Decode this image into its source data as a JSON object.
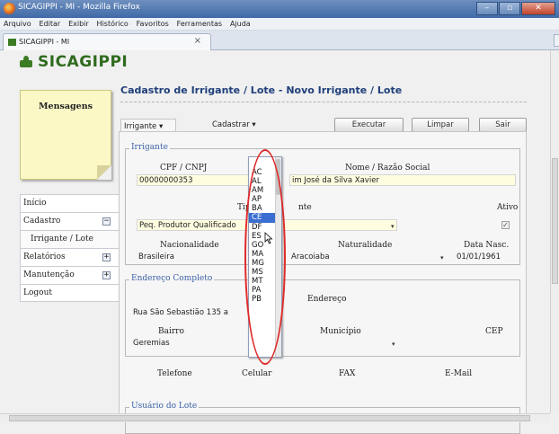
{
  "browser": {
    "window_title": "SICAGIPPI - MI - Mozilla Firefox",
    "menu": [
      "Arquivo",
      "Editar",
      "Exibir",
      "Histórico",
      "Favoritos",
      "Ferramentas",
      "Ajuda"
    ],
    "tab_label": "SICAGIPPI - MI",
    "tab_close": "×"
  },
  "app": {
    "logo_text": "SICAGIPPI",
    "messages_title": "Mensagens"
  },
  "nav": {
    "items": [
      {
        "label": "Início",
        "toggle": ""
      },
      {
        "label": "Cadastro",
        "toggle": "−"
      },
      {
        "label": "Irrigante / Lote",
        "toggle": ""
      },
      {
        "label": "Relatórios",
        "toggle": "+"
      },
      {
        "label": "Manutenção",
        "toggle": "+"
      },
      {
        "label": "Logout",
        "toggle": ""
      }
    ]
  },
  "page": {
    "title": "Cadastro de Irrigante / Lote - Novo Irrigante / Lote"
  },
  "toolbar": {
    "tab_irrigante": "Irrigante",
    "cadastrar": "Cadastrar",
    "executar": "Executar",
    "limpar": "Limpar",
    "sair": "Sair"
  },
  "irrigante": {
    "legend": "Irrigante",
    "cpf_label": "CPF / CNPJ",
    "cpf_value": "00000000353",
    "nome_label": "Nome / Razão Social",
    "nome_value": "im José da Silva Xavier",
    "tipo_label_partial": "Tip",
    "tipo_label_tail": "nte",
    "tipo_value": "Peq. Produtor Qualificado",
    "ativo_label": "Ativo",
    "ativo_check": "✓",
    "nacionalidade_label": "Nacionalidade",
    "nacionalidade_value": "Brasileira",
    "naturalidade_label": "Naturalidade",
    "naturalidade_value": "Aracoiaba",
    "nasc_label": "Data Nasc.",
    "nasc_value": "01/01/1961"
  },
  "endereco": {
    "legend": "Endereço Completo",
    "endereco_label": "Endereço",
    "endereco_value": "Rua São Sebastião 135 a",
    "bairro_label": "Bairro",
    "bairro_value": "Geremias",
    "municipio_label": "Município",
    "cep_label": "CEP"
  },
  "contato": {
    "telefone_label": "Telefone",
    "celular_label": "Celular",
    "fax_label": "FAX",
    "email_label": "E-Mail"
  },
  "usuario": {
    "legend": "Usuário do Lote"
  },
  "uf_dropdown": {
    "options": [
      "AC",
      "AL",
      "AM",
      "AP",
      "BA",
      "CE",
      "DF",
      "ES",
      "GO",
      "MA",
      "MG",
      "MS",
      "MT",
      "PA",
      "PB"
    ],
    "selected": "CE"
  },
  "colors": {
    "accent": "#1f3f7a",
    "brand_green": "#2f6b1f",
    "highlight": "#3a6fd1",
    "annotation_red": "#e02a2a"
  }
}
